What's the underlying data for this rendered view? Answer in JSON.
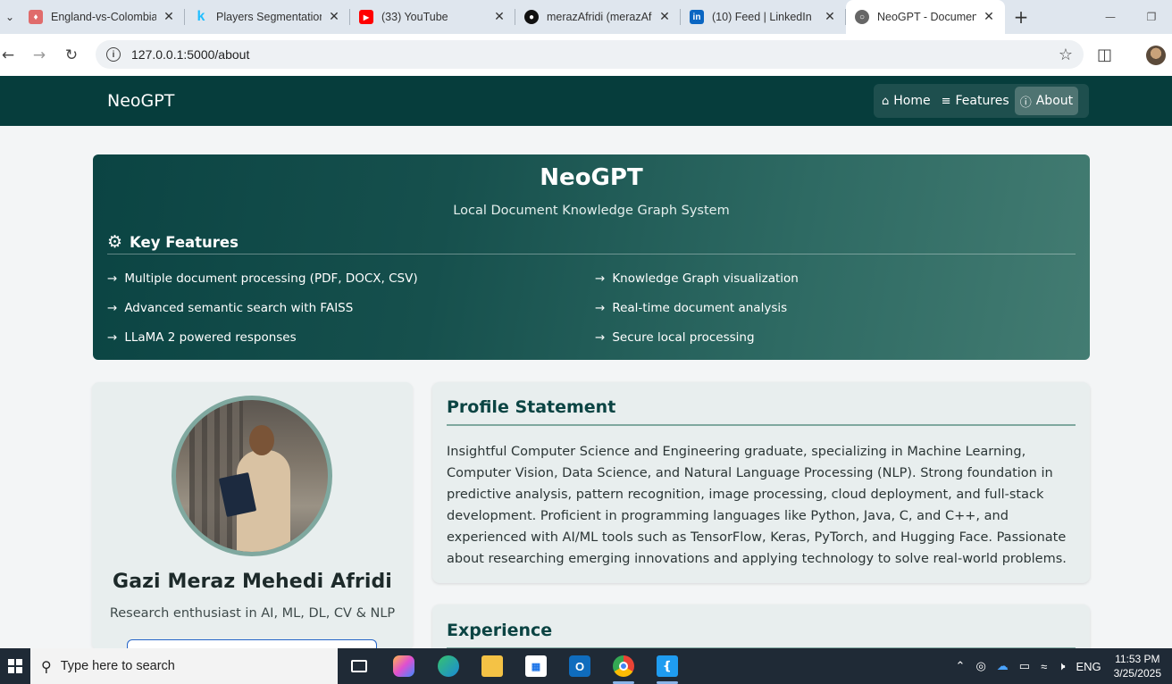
{
  "browser": {
    "tabs": [
      {
        "title": "England-vs-Colombia",
        "favicon": "flask-icon",
        "color": "#e06b6b"
      },
      {
        "title": "Players Segmentation",
        "favicon": "kaggle-icon",
        "color": "#20beff"
      },
      {
        "title": "(33) YouTube",
        "favicon": "youtube-icon",
        "color": "#ff0000"
      },
      {
        "title": "merazAfridi (merazAfridi)",
        "favicon": "github-icon",
        "color": "#111111"
      },
      {
        "title": "(10) Feed | LinkedIn",
        "favicon": "linkedin-icon",
        "color": "#0a66c2"
      },
      {
        "title": "NeoGPT - Document",
        "favicon": "globe-icon",
        "color": "#555555"
      }
    ],
    "url": "127.0.0.1:5000/about"
  },
  "navbar": {
    "brand": "NeoGPT",
    "links": [
      {
        "label": "Home",
        "icon": "home-icon"
      },
      {
        "label": "Features",
        "icon": "list-icon"
      },
      {
        "label": "About",
        "icon": "info-icon"
      }
    ]
  },
  "hero": {
    "title": "NeoGPT",
    "subtitle": "Local Document Knowledge Graph System",
    "features_title": "Key Features",
    "features": [
      "Multiple document processing (PDF, DOCX, CSV)",
      "Knowledge Graph visualization",
      "Advanced semantic search with FAISS",
      "Real-time document analysis",
      "LLaMA 2 powered responses",
      "Secure local processing"
    ]
  },
  "profile": {
    "name": "Gazi Meraz Mehedi Afridi",
    "tagline": "Research enthusiast in AI, ML, DL, CV & NLP"
  },
  "statement": {
    "heading": "Profile Statement",
    "text": "Insightful Computer Science and Engineering graduate, specializing in Machine Learning, Computer Vision, Data Science, and Natural Language Processing (NLP). Strong foundation in predictive analysis, pattern recognition, image processing, cloud deployment, and full-stack development. Proficient in programming languages like Python, Java, C, and C++, and experienced with AI/ML tools such as TensorFlow, Keras, PyTorch, and Hugging Face. Passionate about researching emerging innovations and applying technology to solve real-world problems."
  },
  "experience": {
    "heading": "Experience"
  },
  "taskbar": {
    "search_placeholder": "Type here to search",
    "language": "ENG",
    "time": "11:53 PM",
    "date": "3/25/2025"
  },
  "colors": {
    "navbar_bg": "#063d3c",
    "accent": "#0b4443",
    "card_bg": "#e8eeee"
  }
}
